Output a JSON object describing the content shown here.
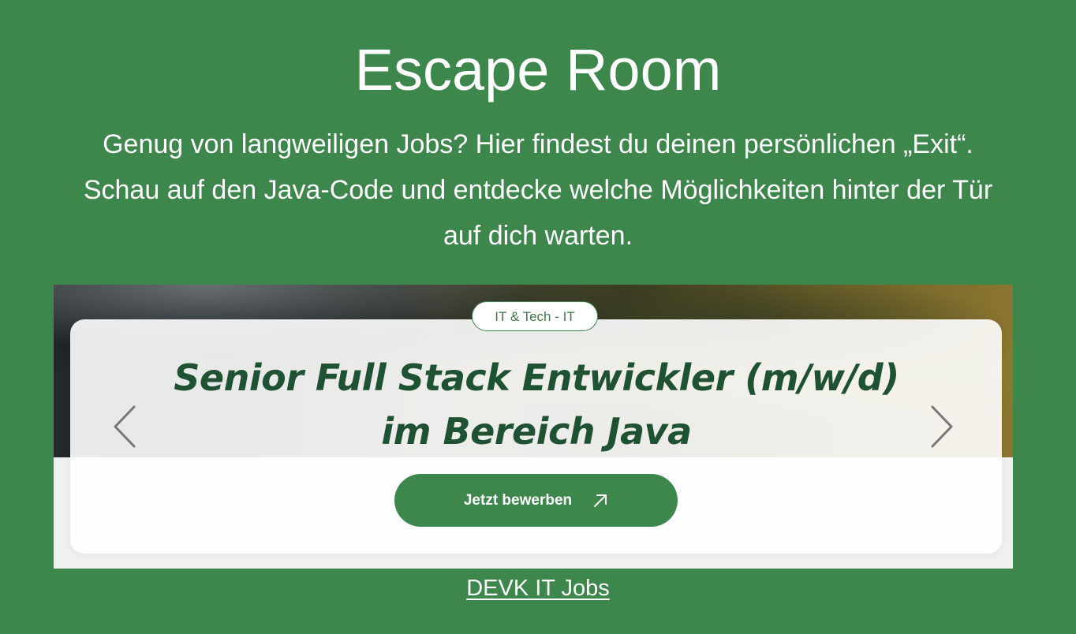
{
  "section": {
    "title": "Escape Room",
    "intro": "Genug von langweiligen Jobs? Hier findest du deinen persönlichen „Exit“. Schau auf den Java-Code und entdecke welche Möglichkeiten hinter der Tür auf dich warten."
  },
  "job_card": {
    "category": "IT & Tech - IT",
    "title_line1": "Senior Full Stack Entwickler (m/w/d)",
    "title_line2": "im Bereich Java",
    "apply_label": "Jetzt bewerben",
    "apply_icon": "external-arrow-icon",
    "prev_icon": "chevron-left-icon",
    "next_icon": "chevron-right-icon"
  },
  "footer": {
    "link_label": "DEVK IT Jobs"
  },
  "colors": {
    "background": "#3d864c",
    "button": "#3d864c",
    "title_text": "#1e5233",
    "text_light": "#ffffff"
  }
}
